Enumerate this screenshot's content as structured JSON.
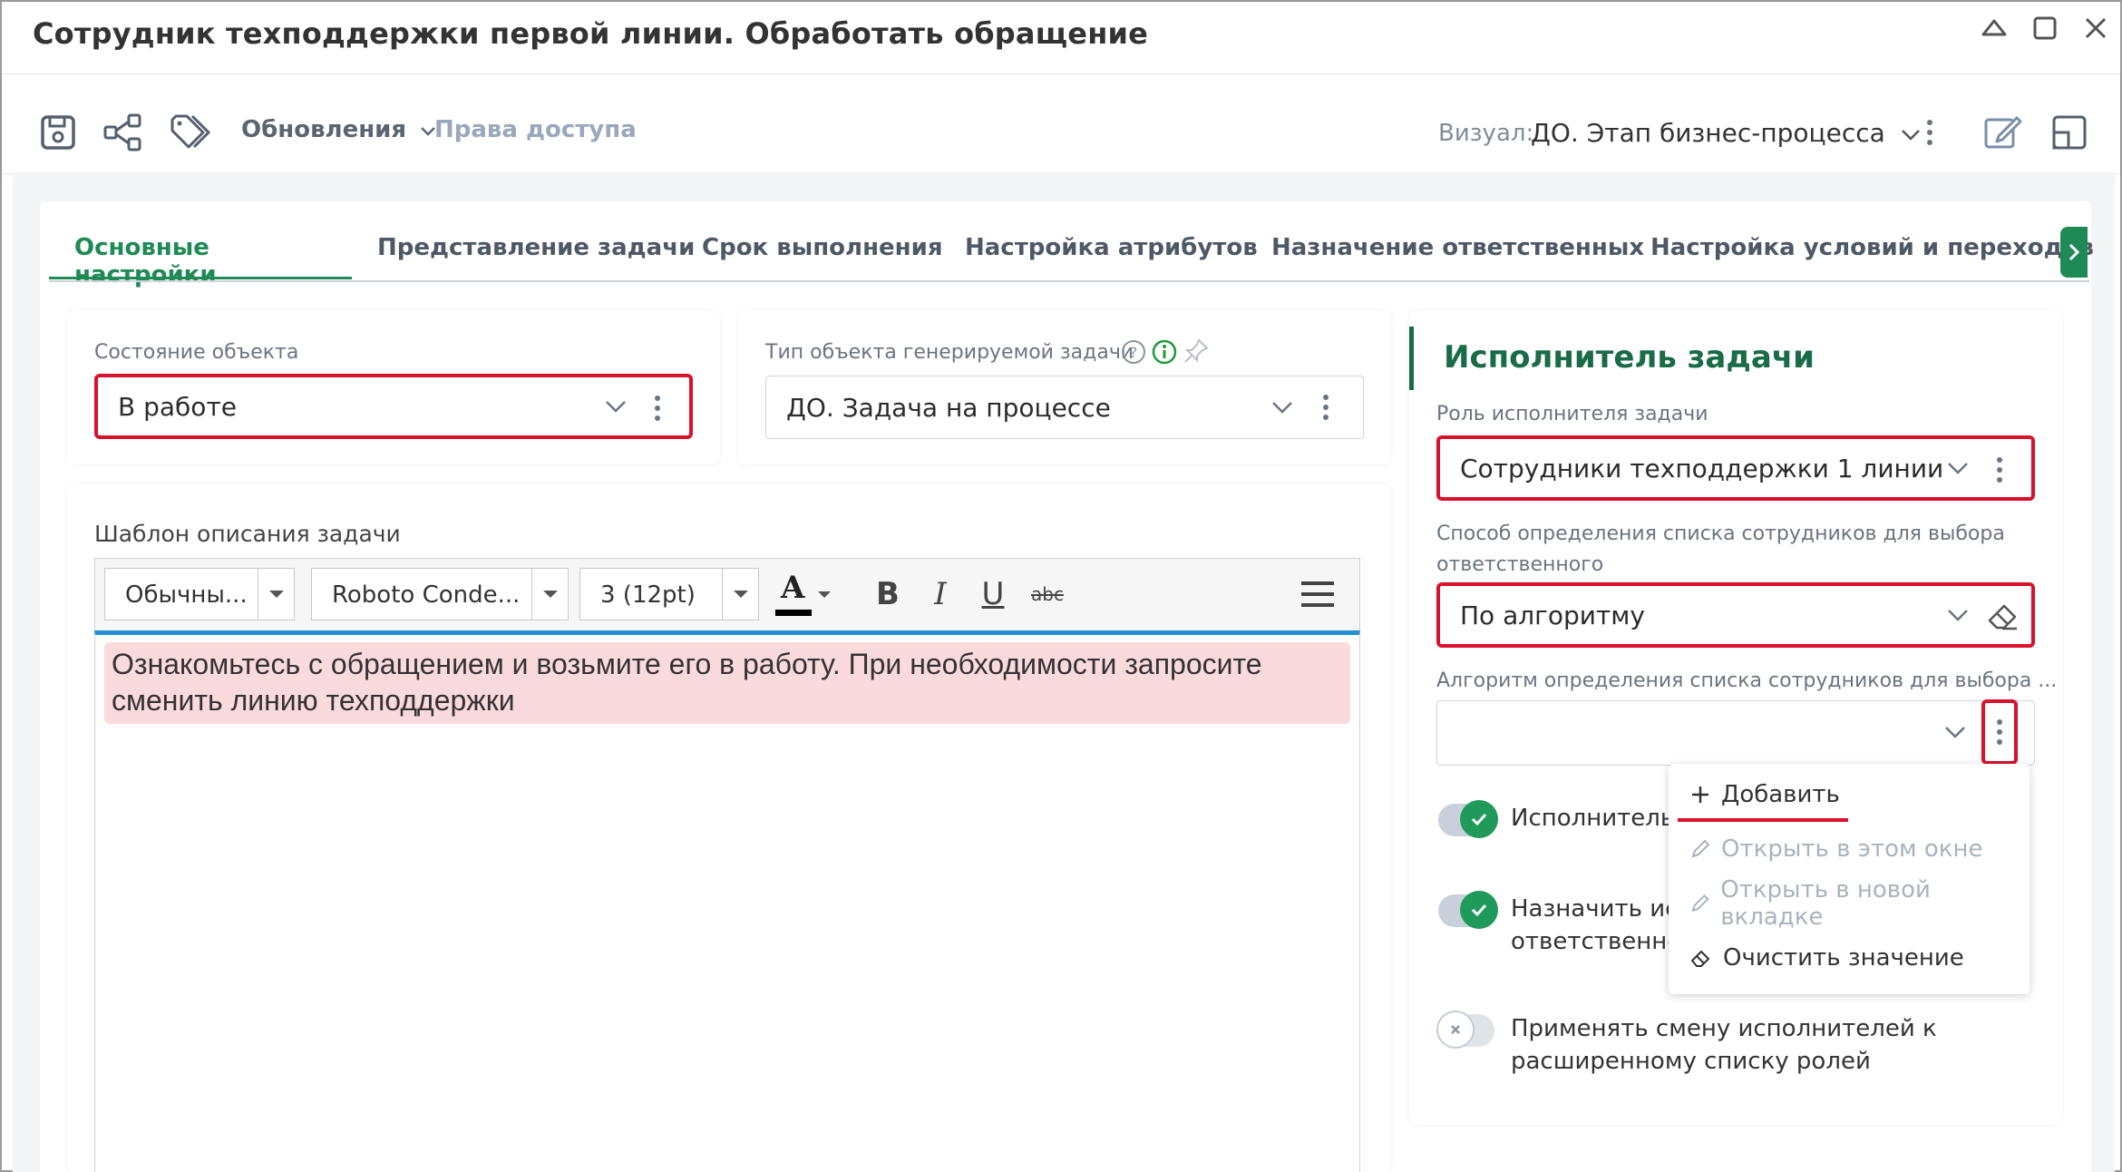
{
  "window": {
    "title": "Сотрудник техподдержки первой линии. Обработать обращение"
  },
  "toolbar": {
    "updates_label": "Обновления",
    "access_label": "Права доступа",
    "visual_label": "Визуал:",
    "visual_value": "ДО. Этап бизнес-процесса"
  },
  "tabs": [
    {
      "label": "Основные настройки",
      "active": true
    },
    {
      "label": "Представление задачи",
      "active": false
    },
    {
      "label": "Срок выполнения",
      "active": false
    },
    {
      "label": "Настройка атрибутов",
      "active": false
    },
    {
      "label": "Назначение ответственных",
      "active": false
    },
    {
      "label": "Настройка условий и переходов",
      "active": false
    }
  ],
  "object_state": {
    "label": "Состояние объекта",
    "value": "В работе"
  },
  "task_type": {
    "label": "Тип объекта генерируемой задачи",
    "value": "ДО. Задача на процессе"
  },
  "template": {
    "label": "Шаблон описания задачи",
    "style_select": "Обычны...",
    "font_select": "Roboto Conde...",
    "size_select": "3 (12pt)",
    "bold": "B",
    "italic": "I",
    "underline": "U",
    "strike": "abc",
    "font_color_glyph": "A",
    "text": "Ознакомьтесь с обращением и возьмите его в работу. При необходимости запросите сменить линию техподдержки"
  },
  "executor": {
    "title": "Исполнитель задачи",
    "role_label": "Роль исполнителя задачи",
    "role_value": "Сотрудники техподдержки 1 линии",
    "method_label_line1": "Способ определения списка сотрудников для выбора",
    "method_label_line2": "ответственного",
    "method_value": "По алгоритму",
    "algorithm_label": "Алгоритм определения списка сотрудников для выбора ...",
    "algorithm_value": ""
  },
  "toggles": [
    {
      "label": "Исполнитель м",
      "on": true
    },
    {
      "label_line1": "Назначить исп",
      "label_line2": "ответственно",
      "on": true
    },
    {
      "label_line1": "Применять смену исполнителей к",
      "label_line2": "расширенному списку ролей",
      "on": false
    }
  ],
  "menu": {
    "add": "Добавить",
    "open_here": "Открыть в этом окне",
    "open_new_tab": "Открыть в новой вкладке",
    "clear": "Очистить значение"
  },
  "colors": {
    "accent_green": "#1f8a56",
    "title_green": "#1a6b47",
    "highlight_red": "#d9112b",
    "editor_blue": "#2391d6",
    "text_highlight": "#fadadd"
  }
}
